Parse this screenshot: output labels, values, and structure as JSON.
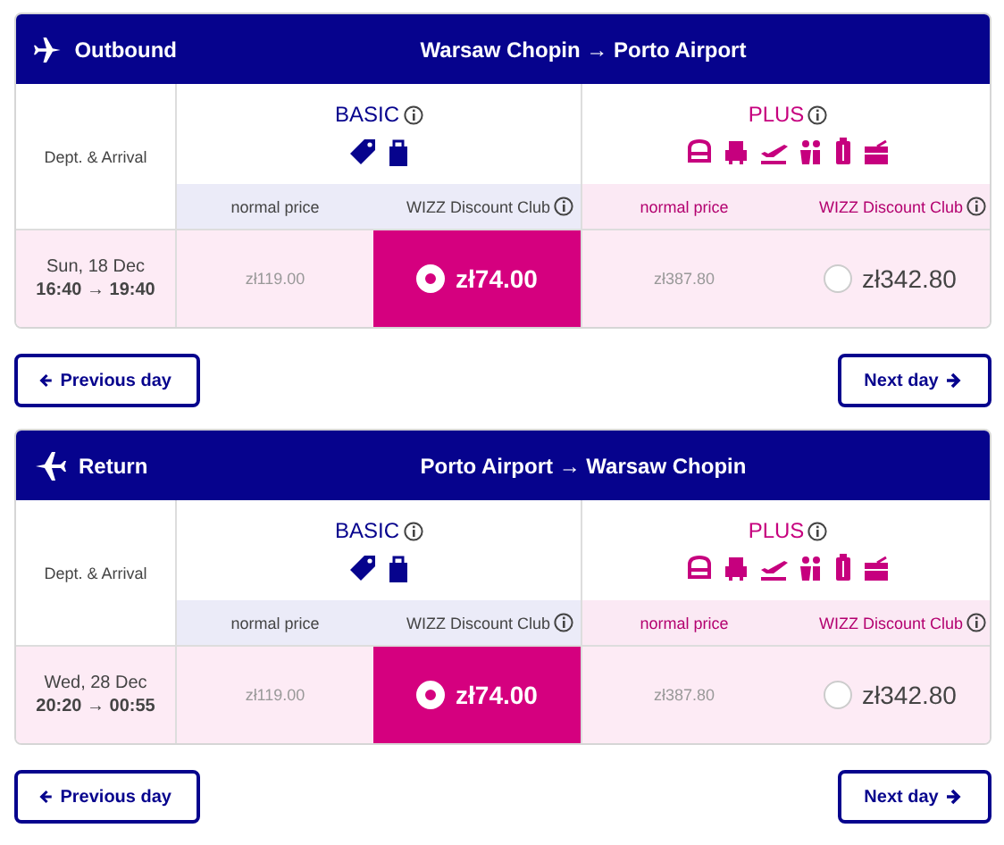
{
  "sections": [
    {
      "kind": "outbound",
      "label": "Outbound",
      "route": "Warsaw Chopin → Porto Airport",
      "dept_label": "Dept. & Arrival",
      "date": "Sun, 18 Dec",
      "times": "16:40 → 19:40",
      "fares": [
        {
          "kind": "basic",
          "name": "BASIC",
          "normal_label": "normal price",
          "club_label": "WIZZ Discount Club",
          "normal_price": "zł119.00",
          "club_price": "zł74.00",
          "selected": true
        },
        {
          "kind": "plus",
          "name": "PLUS",
          "normal_label": "normal price",
          "club_label": "WIZZ Discount Club",
          "normal_price": "zł387.80",
          "club_price": "zł342.80",
          "selected": false
        }
      ],
      "prev_label": "Previous day",
      "next_label": "Next day"
    },
    {
      "kind": "return",
      "label": "Return",
      "route": "Porto Airport → Warsaw Chopin",
      "dept_label": "Dept. & Arrival",
      "date": "Wed, 28 Dec",
      "times": "20:20 → 00:55",
      "fares": [
        {
          "kind": "basic",
          "name": "BASIC",
          "normal_label": "normal price",
          "club_label": "WIZZ Discount Club",
          "normal_price": "zł119.00",
          "club_price": "zł74.00",
          "selected": true
        },
        {
          "kind": "plus",
          "name": "PLUS",
          "normal_label": "normal price",
          "club_label": "WIZZ Discount Club",
          "normal_price": "zł387.80",
          "club_price": "zł342.80",
          "selected": false
        }
      ],
      "prev_label": "Previous day",
      "next_label": "Next day"
    }
  ]
}
